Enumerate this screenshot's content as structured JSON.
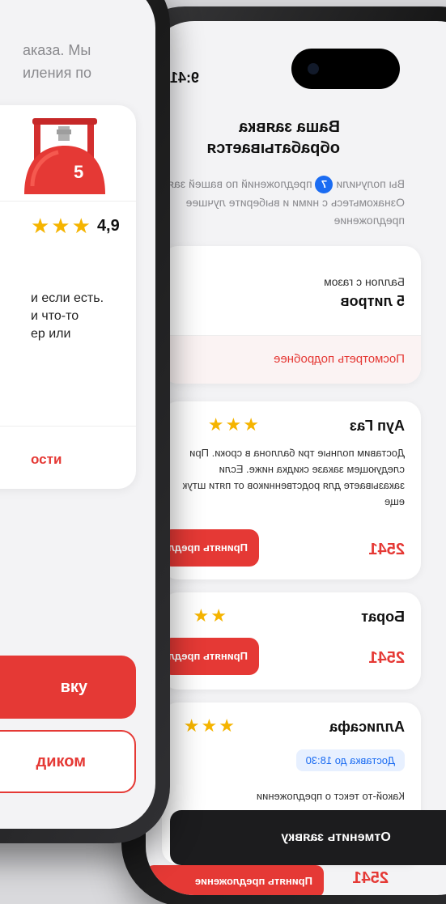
{
  "front_phone": {
    "intro_text_lines": [
      "аказа. Мы",
      "иления по"
    ],
    "rating_value": "4,9",
    "description_lines": [
      "и если есть.",
      "и  что-то",
      "ер или"
    ],
    "details_link": "ости",
    "primary_button": "вку",
    "secondary_button": "диком",
    "cylinder_label": "5"
  },
  "back_phone": {
    "time": "9:41",
    "title": "Ваша заявка обрабатывается",
    "subtitle_prefix": "Вы получили",
    "offers_count": "7",
    "subtitle_suffix": "предложений по вашей заявке. Ознакомьтесь с ними и выберите лучшее предложение",
    "request_card": {
      "label": "Баллон с газом",
      "volume": "5 литров",
      "details_link": "Посмотреть подробнее"
    },
    "offers": [
      {
        "name": "Ауп Газ",
        "description": "Доставим полные три баллона в сроки. При следующем заказе скидка ниже. Если заказываете для родственников  от пяти штук еще",
        "price": "2541",
        "accept_label": "Принять предложение"
      },
      {
        "name": "Борат",
        "price": "2541",
        "accept_label": "Принять предложение"
      },
      {
        "name": "Аллисафа",
        "delivery": "Доставка до 18:30",
        "description": "Какой-то текст о предложении",
        "price": "2541",
        "accept_label": "Принять предложение"
      }
    ],
    "cancel_button": "Отменить заявку"
  },
  "colors": {
    "accent": "#e53935",
    "star": "#f5b400",
    "badge": "#1b6cf2"
  }
}
